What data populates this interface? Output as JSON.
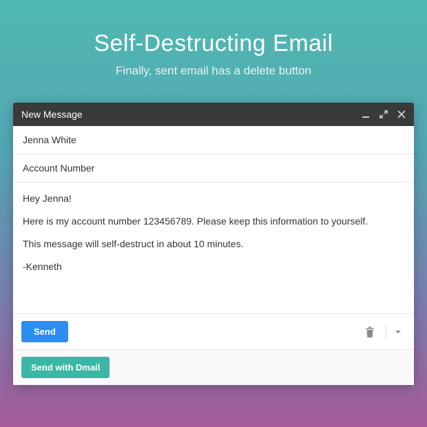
{
  "hero": {
    "title": "Self-Destructing Email",
    "subtitle": "Finally, sent email has a delete button"
  },
  "compose": {
    "title": "New Message",
    "to": "Jenna White",
    "subject": "Account Number",
    "body": {
      "greeting": "Hey Jenna!",
      "line1": "Here is my account number 123456789. Please keep this information to yourself.",
      "line2": "This message will self-destruct in about 10 minutes.",
      "signoff": "-Kenneth"
    },
    "send_label": "Send",
    "dmail_label": "Send with Dmail"
  }
}
